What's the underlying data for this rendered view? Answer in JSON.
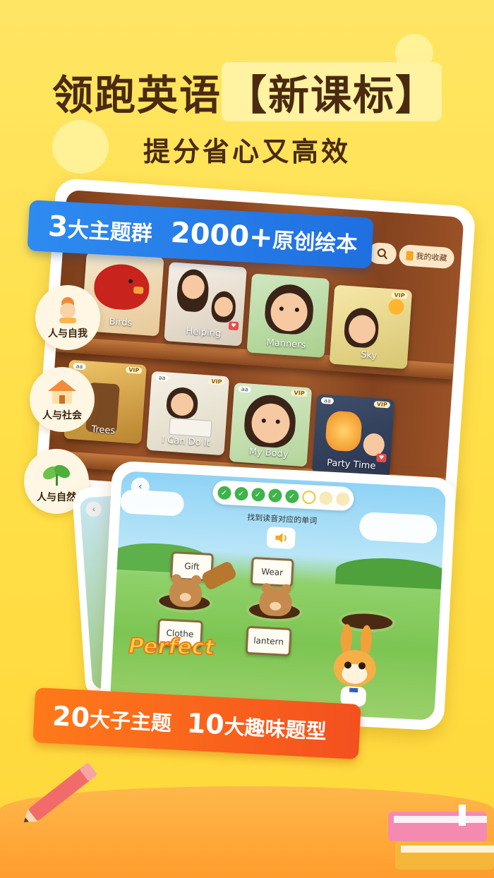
{
  "headline": {
    "main": "领跑英语",
    "bracket": "【新课标】",
    "sub": "提分省心又高效"
  },
  "banner_top": {
    "num": "3",
    "text1": "大主题群",
    "num2": "2000+",
    "text2": "原创绘本"
  },
  "banner_bottom": {
    "num": "20",
    "text1": "大子主题",
    "num2": "10",
    "text2": "大趣味题型"
  },
  "side_topics": [
    {
      "label": "人与自我",
      "icon": "person-icon"
    },
    {
      "label": "人与社会",
      "icon": "house-icon"
    },
    {
      "label": "人与自然",
      "icon": "leaf-icon"
    }
  ],
  "library": {
    "collect_label": "我的收藏",
    "books_row1": [
      {
        "title": "Birds"
      },
      {
        "title": "Helping"
      },
      {
        "title": "Manners"
      },
      {
        "title": "Sky",
        "vip": "VIP"
      }
    ],
    "books_row2": [
      {
        "title": "Trees",
        "vip": "VIP",
        "aa": "aa"
      },
      {
        "title": "I Can Do It",
        "vip": "VIP",
        "aa": "aa"
      },
      {
        "title": "My Body",
        "vip": "VIP",
        "aa": "aa"
      },
      {
        "title": "Party Time",
        "vip": "VIP",
        "aa": "aa"
      }
    ]
  },
  "game": {
    "instruction": "找到读音对应的单词",
    "progress_done": 5,
    "progress_total": 8,
    "cards": [
      "Gift",
      "Wear",
      "Clothe",
      "lantern"
    ],
    "feedback": "Perfect"
  },
  "colors": {
    "background": "#FFE04A",
    "headline": "#4A2A10",
    "banner_blue": "#2E8BF0",
    "banner_orange": "#FF7A1A",
    "progress_done": "#3EB44A"
  }
}
